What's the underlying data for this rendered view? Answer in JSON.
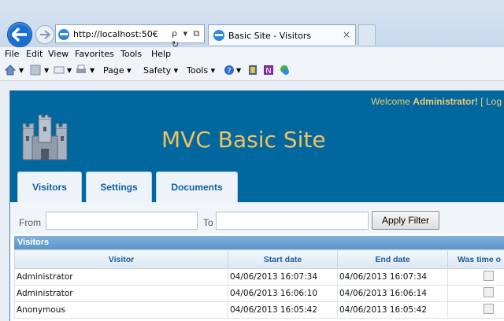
{
  "browser": {
    "url": "http://localhost:50€",
    "tab_title": "Basic Site - Visitors",
    "tab_close": "×",
    "address_tools": "ρ ▾ ⧉ ↻",
    "menu": [
      "File",
      "Edit",
      "View",
      "Favorites",
      "Tools",
      "Help"
    ],
    "commands": [
      "Page ▾",
      "Safety ▾",
      "Tools ▾"
    ]
  },
  "site": {
    "welcome_prefix": "Welcome ",
    "welcome_user": "Administrator!",
    "welcome_suffix": " [ Log",
    "title": "MVC Basic Site",
    "nav": [
      "Visitors",
      "Settings",
      "Documents"
    ]
  },
  "filter": {
    "from_label": "From",
    "to_label": "To",
    "apply_label": "Apply Filter"
  },
  "grid": {
    "caption": "Visitors",
    "columns": [
      "Visitor",
      "Start date",
      "End date",
      "Was time o"
    ],
    "rows": [
      {
        "visitor": "Administrator",
        "start": "04/06/2013 16:07:34",
        "end": "04/06/2013 16:07:34"
      },
      {
        "visitor": "Administrator",
        "start": "04/06/2013 16:06:10",
        "end": "04/06/2013 16:06:14"
      },
      {
        "visitor": "Anonymous",
        "start": "04/06/2013 16:05:42",
        "end": "04/06/2013 16:05:42"
      }
    ]
  }
}
